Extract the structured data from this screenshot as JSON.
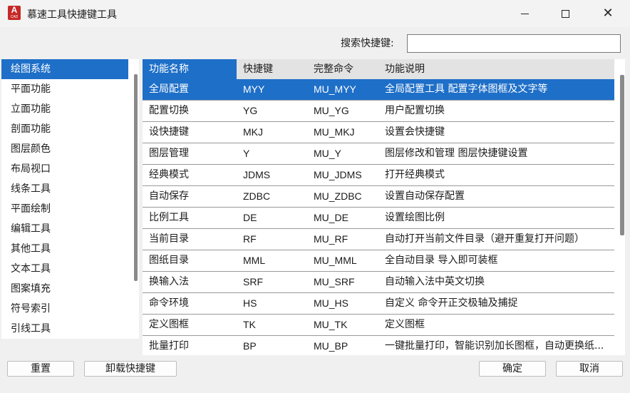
{
  "window": {
    "title": "慕速工具快捷键工具",
    "app_icon_letter": "A",
    "app_icon_sub": "CAD",
    "minimize_icon": "minimize-icon",
    "maximize_icon": "maximize-icon",
    "close_glyph": "✕"
  },
  "search": {
    "label": "搜索快捷键:",
    "value": "",
    "placeholder": ""
  },
  "sidebar": {
    "items": [
      {
        "label": "绘图系统",
        "selected": true
      },
      {
        "label": "平面功能"
      },
      {
        "label": "立面功能"
      },
      {
        "label": "剖面功能"
      },
      {
        "label": "图层颜色"
      },
      {
        "label": "布局视口"
      },
      {
        "label": "线条工具"
      },
      {
        "label": "平面绘制"
      },
      {
        "label": "编辑工具"
      },
      {
        "label": "其他工具"
      },
      {
        "label": "文本工具"
      },
      {
        "label": "图案填充"
      },
      {
        "label": "符号索引"
      },
      {
        "label": "引线工具"
      }
    ]
  },
  "table": {
    "headers": [
      "功能名称",
      "快捷键",
      "完整命令",
      "功能说明"
    ],
    "rows": [
      [
        "全局配置",
        "MYY",
        "MU_MYY",
        "全局配置工具 配置字体图框及文字等"
      ],
      [
        "配置切换",
        "YG",
        "MU_YG",
        "用户配置切换"
      ],
      [
        "设快捷键",
        "MKJ",
        "MU_MKJ",
        "设置会快捷键"
      ],
      [
        "图层管理",
        "Y",
        "MU_Y",
        "图层修改和管理 图层快捷键设置"
      ],
      [
        "经典模式",
        "JDMS",
        "MU_JDMS",
        "打开经典模式"
      ],
      [
        "自动保存",
        "ZDBC",
        "MU_ZDBC",
        "设置自动保存配置"
      ],
      [
        "比例工具",
        "DE",
        "MU_DE",
        "设置绘图比例"
      ],
      [
        "当前目录",
        "RF",
        "MU_RF",
        "自动打开当前文件目录（避开重复打开问题）"
      ],
      [
        "图纸目录",
        "MML",
        "MU_MML",
        "全自动目录 导入即可装框"
      ],
      [
        "换输入法",
        "SRF",
        "MU_SRF",
        "自动输入法中英文切换"
      ],
      [
        "命令环境",
        "HS",
        "MU_HS",
        "自定义 命令开正交极轴及捕捉"
      ],
      [
        "定义图框",
        "TK",
        "MU_TK",
        "定义图框"
      ],
      [
        "批量打印",
        "BP",
        "MU_BP",
        "一键批量打印，智能识别加长图框，自动更换纸..."
      ]
    ]
  },
  "buttons": {
    "reset": "重置",
    "unload": "卸载快捷键",
    "ok": "确定",
    "cancel": "取消"
  },
  "colors": {
    "accent": "#1e6fc8",
    "app_icon": "#c62828"
  }
}
